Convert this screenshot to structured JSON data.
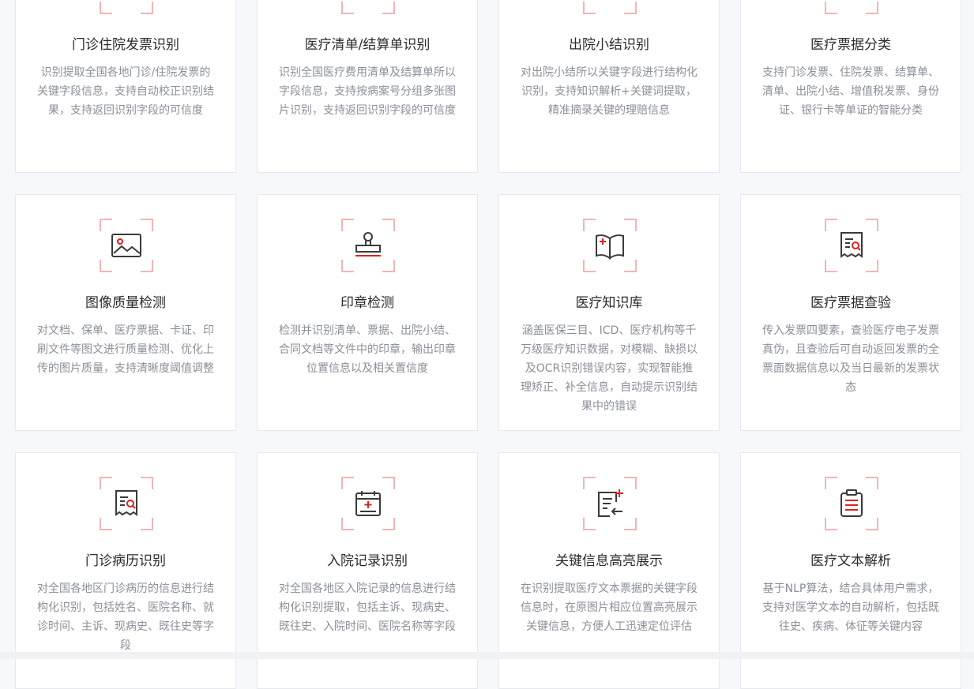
{
  "cards": [
    {
      "title": "门诊住院发票识别",
      "desc": "识别提取全国各地门诊/住院发票的关键字段信息，支持自动校正识别结果，支持返回识别字段的可信度",
      "icon": "invoice-icon"
    },
    {
      "title": "医疗清单/结算单识别",
      "desc": "识别全国医疗费用清单及结算单所以字段信息，支持按病案号分组多张图片识别，支持返回识别字段的可信度",
      "icon": "list-icon"
    },
    {
      "title": "出院小结识别",
      "desc": "对出院小结所以关键字段进行结构化识别，支持知识解析+关键词提取，精准摘录关键的理赔信息",
      "icon": "discharge-icon"
    },
    {
      "title": "医疗票据分类",
      "desc": "支持门诊发票、住院发票、结算单、清单、出院小结、增值税发票、身份证、银行卡等单证的智能分类",
      "icon": "classify-icon"
    },
    {
      "title": "图像质量检测",
      "desc": "对文档、保单、医疗票据、卡证、印刷文件等图文进行质量检测、优化上传的图片质量，支持清晰度阈值调整",
      "icon": "image-icon"
    },
    {
      "title": "印章检测",
      "desc": "检测并识别清单、票据、出院小结、合同文档等文件中的印章，输出印章位置信息以及相关置信度",
      "icon": "stamp-icon"
    },
    {
      "title": "医疗知识库",
      "desc": "涵盖医保三目、ICD、医疗机构等千万级医疗知识数据，对模糊、缺损以及OCR识别错误内容，实现智能推理矫正、补全信息，自动提示识别结果中的错误",
      "icon": "medical-book-icon"
    },
    {
      "title": "医疗票据查验",
      "desc": "传入发票四要素，查验医疗电子发票真伪，且查验后可自动返回发票的全票面数据信息以及当日最新的发票状态",
      "icon": "receipt-search-icon"
    },
    {
      "title": "门诊病历识别",
      "desc": "对全国各地区门诊病历的信息进行结构化识别，包括姓名、医院名称、就诊时间、主诉、现病史、既往史等字段",
      "icon": "receipt-search-icon"
    },
    {
      "title": "入院记录识别",
      "desc": "对全国各地区入院记录的信息进行结构化识别提取，包括主诉、现病史、既往史、入院时间、医院名称等字段",
      "icon": "calendar-medical-icon"
    },
    {
      "title": "关键信息高亮展示",
      "desc": "在识别提取医疗文本票据的关键字段信息时，在原图片相应位置高亮展示关键信息，方便人工迅速定位评估",
      "icon": "document-plus-icon"
    },
    {
      "title": "医疗文本解析",
      "desc": "基于NLP算法，结合具体用户需求，支持对医学文本的自动解析，包括既往史、疾病、体征等关键内容",
      "icon": "clipboard-icon"
    }
  ],
  "colors": {
    "accent": "#e02020",
    "stroke": "#3a3a3a",
    "corner": "#f2b5b5"
  }
}
